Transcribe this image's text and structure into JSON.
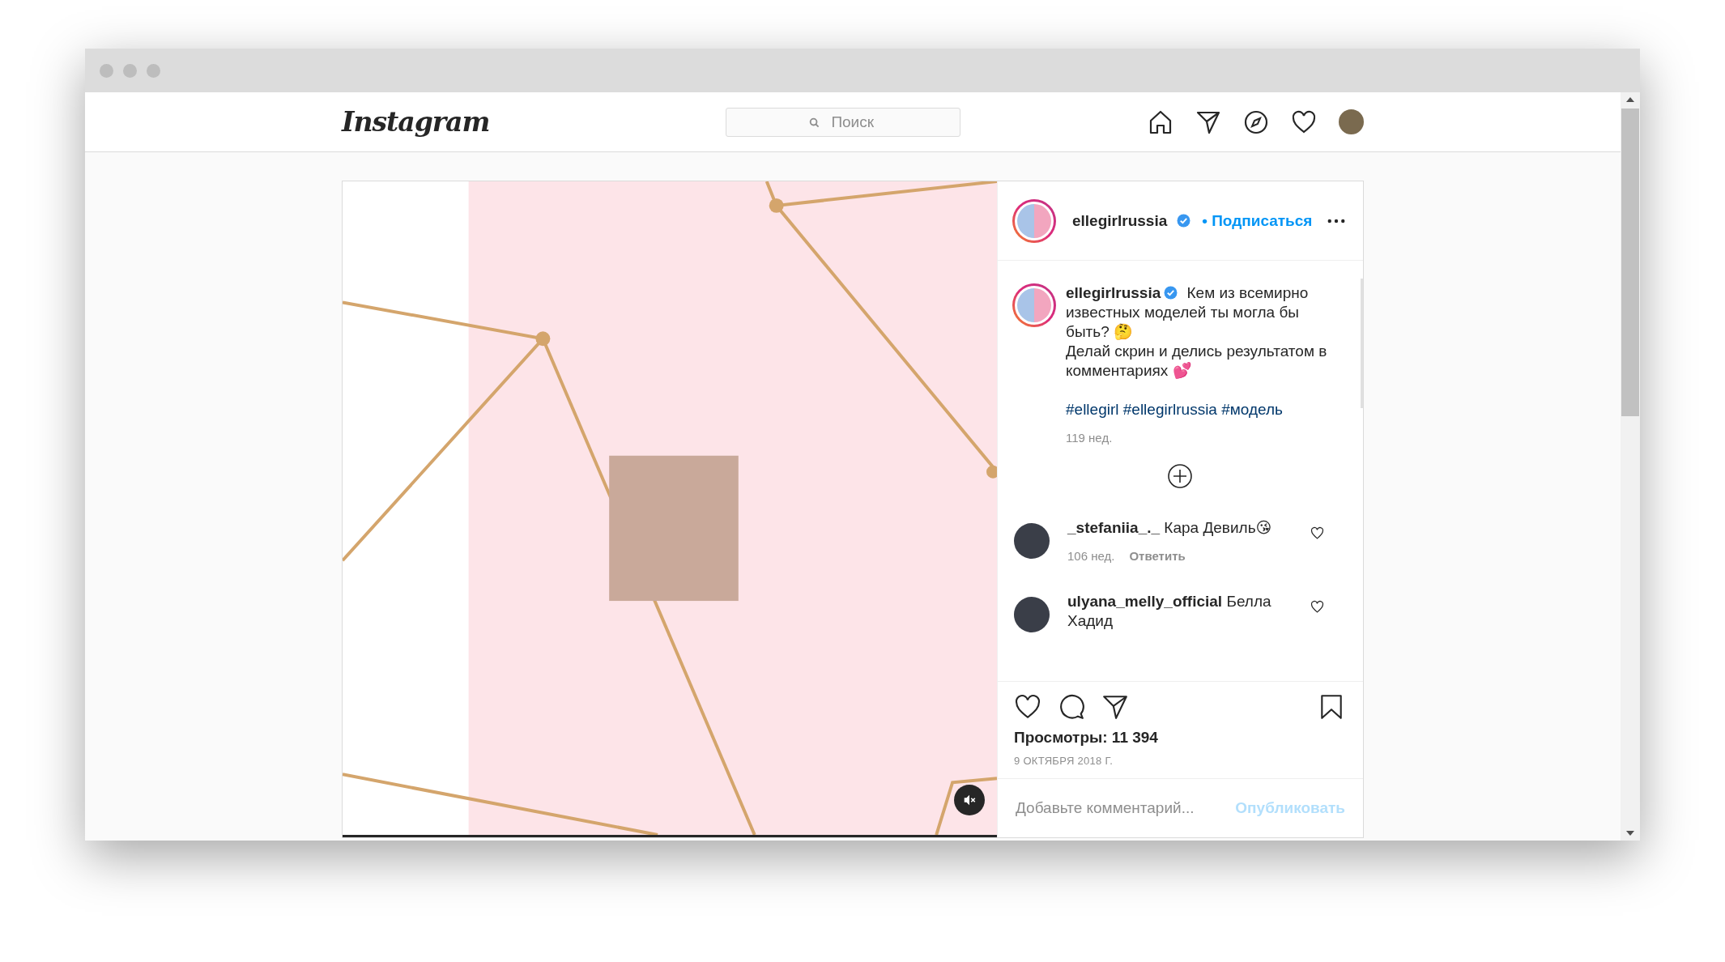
{
  "nav": {
    "logo": "Instagram",
    "search": {
      "placeholder": "Поиск"
    }
  },
  "post": {
    "media": {
      "muted": true
    },
    "author": {
      "username": "ellegirlrussia",
      "verified": true,
      "story_ring": true,
      "follow": "• Подписаться"
    },
    "caption": {
      "username": "ellegirlrussia",
      "verified": true,
      "lines": [
        "Кем из всемирно известных моделей ты могла бы быть? 🤔",
        "Делай скрин и делись результатом в комментариях 💕"
      ],
      "hashtags": [
        "#ellegirl",
        "#ellegirlrussia",
        "#модель"
      ],
      "time": "119 нед."
    },
    "comments": [
      {
        "username": "_stefaniia_._",
        "text": "Кара Девиль😘",
        "time": "106 нед.",
        "reply": "Ответить",
        "liked": false
      },
      {
        "username": "ulyana_melly_official",
        "text": "Белла Хадид",
        "liked": false
      }
    ],
    "liked": false,
    "saved": false,
    "views": "Просмотры: 11 394",
    "date": "9 ОКТЯБРЯ 2018 Г.",
    "comment_box": {
      "placeholder": "Добавьте комментарий...",
      "submit": "Опубликовать",
      "submit_disabled": true
    }
  }
}
